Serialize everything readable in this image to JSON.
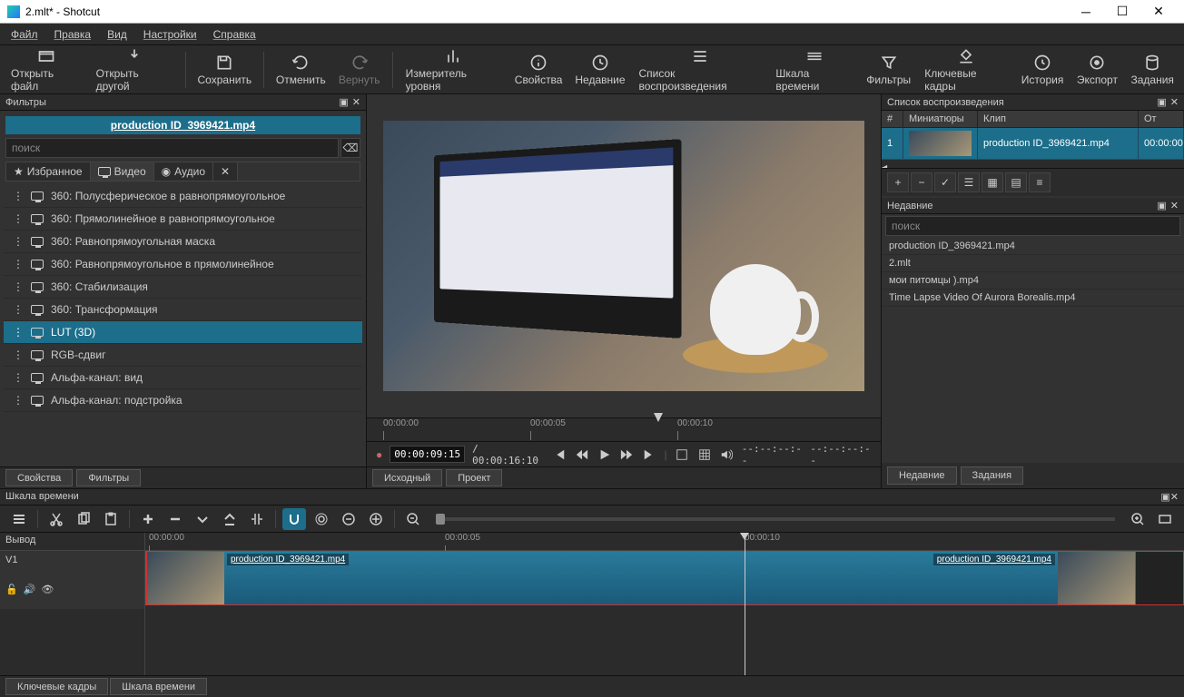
{
  "window": {
    "title": "2.mlt* - Shotcut"
  },
  "menu": {
    "file": "Файл",
    "edit": "Правка",
    "view": "Вид",
    "settings": "Настройки",
    "help": "Справка"
  },
  "toolbar": {
    "open": "Открыть файл",
    "open_other": "Открыть другой",
    "save": "Сохранить",
    "undo": "Отменить",
    "redo": "Вернуть",
    "peak": "Измеритель уровня",
    "props": "Свойства",
    "recent": "Недавние",
    "playlist": "Список воспроизведения",
    "timeline": "Шкала времени",
    "filters": "Фильтры",
    "keyframes": "Ключевые кадры",
    "history": "История",
    "export": "Экспорт",
    "jobs": "Задания"
  },
  "filters_panel": {
    "title": "Фильтры",
    "current_clip": "production ID_3969421.mp4",
    "search_placeholder": "поиск",
    "tabs": {
      "favorite": "Избранное",
      "video": "Видео",
      "audio": "Аудио"
    },
    "items": [
      "360: Полусферическое в равнопрямоугольное",
      "360: Прямолинейное в равнопрямоугольное",
      "360: Равнопрямоугольная маска",
      "360: Равнопрямоугольное в прямолинейное",
      "360: Стабилизация",
      "360: Трансформация",
      "LUT (3D)",
      "RGB-сдвиг",
      "Альфа-канал: вид",
      "Альфа-канал: подстройка"
    ],
    "selected_index": 6
  },
  "bottom_tabs": {
    "props": "Свойства",
    "filters": "Фильтры"
  },
  "preview": {
    "ruler": [
      "00:00:00",
      "00:00:05",
      "00:00:10"
    ],
    "current": "00:00:09:15",
    "total": "00:00:16:10",
    "inout": "--:--:--:--",
    "duration": "--:--:--:--",
    "src_tab": "Исходный",
    "proj_tab": "Проект"
  },
  "playlist": {
    "title": "Список воспроизведения",
    "cols": {
      "num": "#",
      "thumb": "Миниатюры",
      "clip": "Клип",
      "from": "От"
    },
    "row": {
      "num": "1",
      "clip": "production ID_3969421.mp4",
      "from": "00:00:00"
    }
  },
  "recent": {
    "title": "Недавние",
    "search_placeholder": "поиск",
    "items": [
      "production ID_3969421.mp4",
      "2.mlt",
      "мои питомцы ).mp4",
      "Time Lapse Video Of Aurora Borealis.mp4"
    ]
  },
  "right_tabs": {
    "recent": "Недавние",
    "jobs": "Задания"
  },
  "timeline": {
    "title": "Шкала времени",
    "output": "Вывод",
    "track": "V1",
    "ruler": [
      "00:00:00",
      "00:00:05",
      "00:00:10"
    ],
    "clip1": "production ID_3969421.mp4",
    "clip2": "production ID_3969421.mp4",
    "tabs": {
      "keyframes": "Ключевые кадры",
      "timeline": "Шкала времени"
    }
  }
}
